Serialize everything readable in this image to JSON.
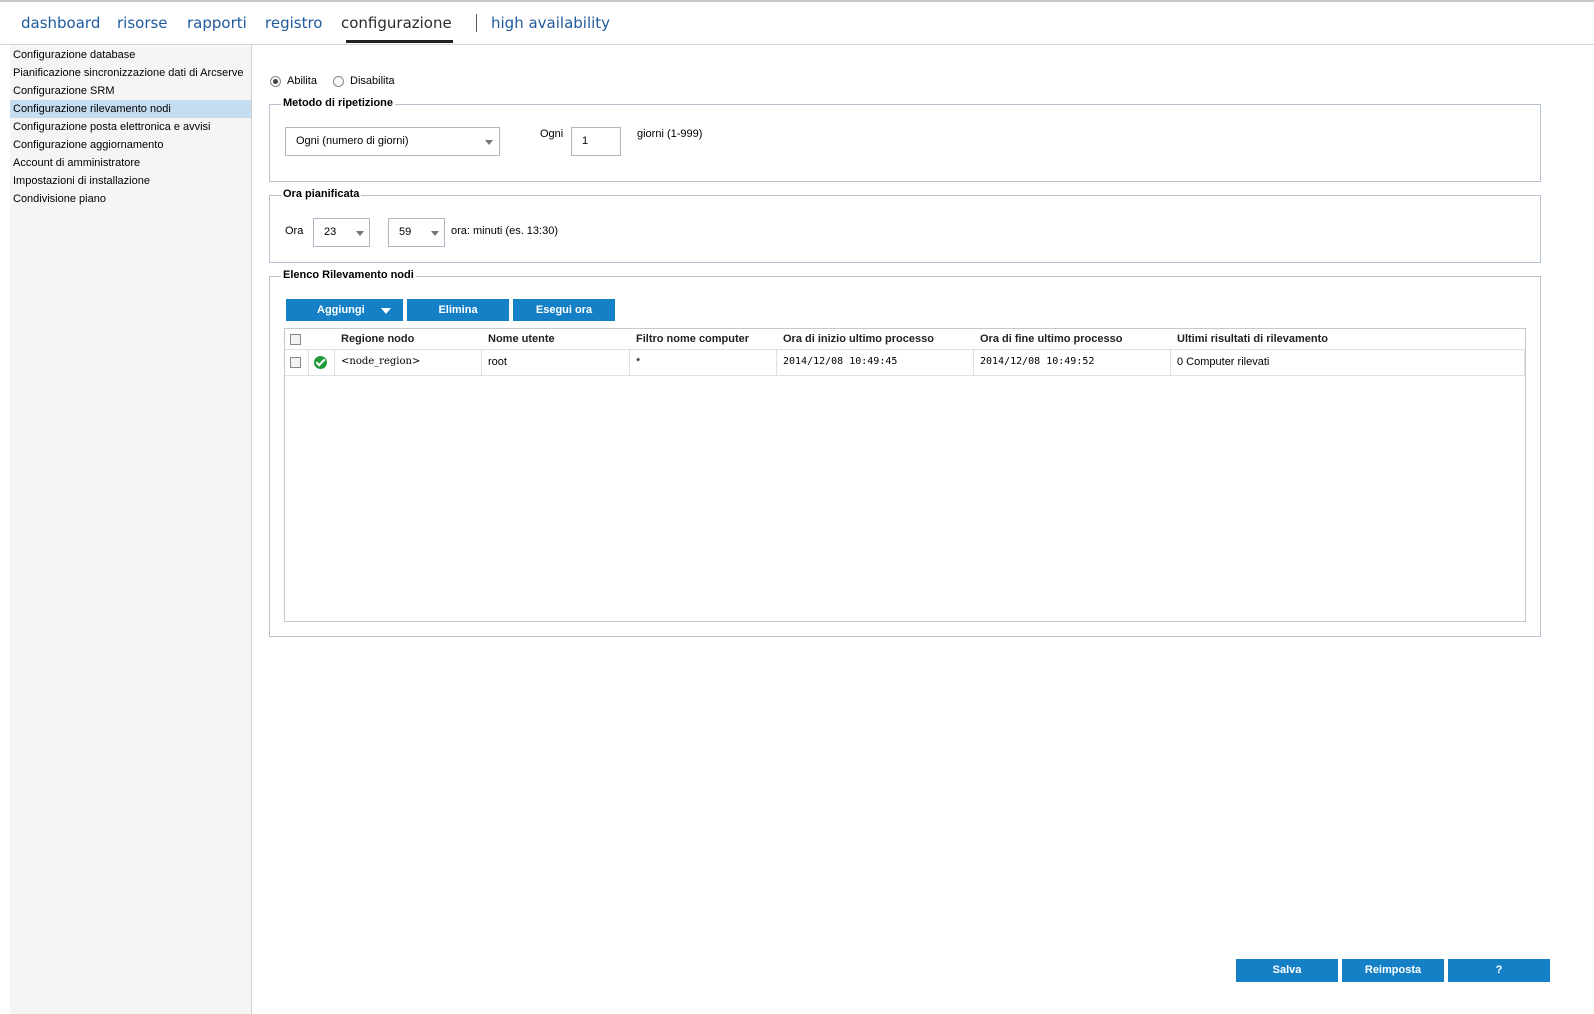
{
  "nav": {
    "tabs": [
      {
        "label": "dashboard"
      },
      {
        "label": "risorse"
      },
      {
        "label": "rapporti"
      },
      {
        "label": "registro"
      },
      {
        "label": "configurazione",
        "active": true
      },
      {
        "label": "high availability"
      }
    ]
  },
  "sidebar": {
    "items": [
      {
        "label": "Configurazione database"
      },
      {
        "label": "Pianificazione sincronizzazione dati di Arcserve"
      },
      {
        "label": "Configurazione SRM"
      },
      {
        "label": "Configurazione rilevamento nodi",
        "active": true
      },
      {
        "label": "Configurazione posta elettronica e avvisi"
      },
      {
        "label": "Configurazione aggiornamento"
      },
      {
        "label": "Account di amministratore"
      },
      {
        "label": "Impostazioni di installazione"
      },
      {
        "label": "Condivisione piano"
      }
    ]
  },
  "enable": {
    "enable_label": "Abilita",
    "disable_label": "Disabilita",
    "selected": "Abilita"
  },
  "repeat": {
    "legend": "Metodo di ripetizione",
    "method_value": "Ogni (numero di giorni)",
    "every_label": "Ogni",
    "days_value": "1",
    "days_hint": "giorni (1-999)"
  },
  "schedule": {
    "legend": "Ora pianificata",
    "hour_label": "Ora",
    "hour_value": "23",
    "minute_value": "59",
    "format_hint": "ora: minuti (es. 13:30)"
  },
  "discovery": {
    "legend": "Elenco Rilevamento nodi",
    "add_label": "Aggiungi",
    "delete_label": "Elimina",
    "run_label": "Esegui ora",
    "columns": [
      "Regione nodo",
      "Nome utente",
      "Filtro nome computer",
      "Ora di inizio ultimo processo",
      "Ora di fine ultimo processo",
      "Ultimi risultati di rilevamento"
    ],
    "rows": [
      {
        "status_icon": "check-circle-icon",
        "region": "<node_region>",
        "user": "root",
        "filter": "*",
        "start": "2014/12/08 10:49:45",
        "end": "2014/12/08 10:49:52",
        "result": "0 Computer rilevati"
      }
    ]
  },
  "footer": {
    "save_label": "Salva",
    "reset_label": "Reimposta",
    "help_label": "?"
  },
  "colors": {
    "accent": "#1580c6",
    "nav_link": "#1f5a9e",
    "selected_row": "#c5ddf0",
    "status_ok": "#1f9a3b"
  }
}
